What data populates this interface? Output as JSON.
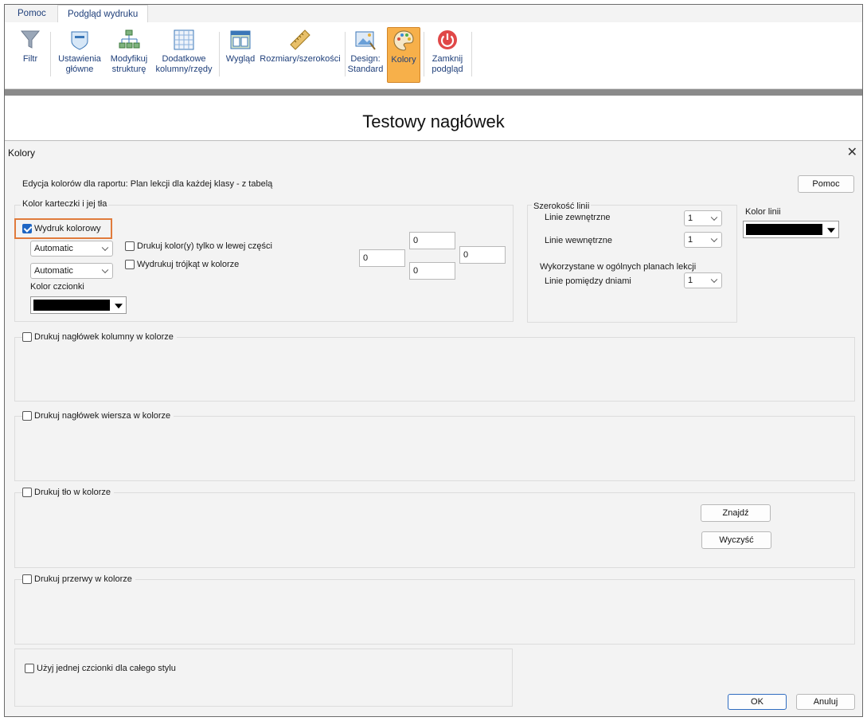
{
  "tabs": [
    {
      "label": "Pomoc"
    },
    {
      "label": "Podgląd wydruku"
    }
  ],
  "ribbon": {
    "filter": "Filtr",
    "main_settings": [
      "Ustawienia",
      "główne"
    ],
    "modify_structure": [
      "Modyfikuj",
      "strukturę"
    ],
    "extra_cols": [
      "Dodatkowe",
      "kolumny/rzędy"
    ],
    "appearance": "Wygląd",
    "sizes": "Rozmiary/szerokości",
    "design": [
      "Design:",
      "Standard"
    ],
    "colors": "Kolory",
    "close_preview": [
      "Zamknij",
      "podgląd"
    ]
  },
  "preview": {
    "header": "Testowy nagłówek"
  },
  "dialog": {
    "title": "Kolory",
    "close": "✕",
    "subtitle": "Edycja kolorów dla raportu: Plan lekcji dla każdej klasy - z tabelą",
    "help_button": "Pomoc",
    "card_group": {
      "label": "Kolor karteczki i jej tła",
      "color_print": {
        "label": "Wydruk kolorowy",
        "checked": true
      },
      "select1": "Automatic",
      "select2": "Automatic",
      "left_only": "Drukuj kolor(y) tylko w lewej części",
      "triangle": "Wydrukuj trójkąt w kolorze",
      "font_color": "Kolor czcionki",
      "margins": {
        "top": "0",
        "left": "0",
        "right": "0",
        "bottom": "0"
      }
    },
    "line_width": {
      "label": "Szerokość linii",
      "outer": "Linie zewnętrzne",
      "outer_value": "1",
      "inner": "Linie wewnętrzne",
      "inner_value": "1",
      "general_label": "Wykorzystane w ogólnych planach lekcji",
      "between_days": "Linie pomiędzy dniami",
      "between_days_value": "1"
    },
    "line_color_label": "Kolor linii",
    "col_header": "Drukuj nagłówek kolumny w kolorze",
    "row_header": "Drukuj nagłówek wiersza w kolorze",
    "background": "Drukuj tło w kolorze",
    "find_button": "Znajdź",
    "clear_button": "Wyczyść",
    "breaks": "Drukuj przerwy w kolorze",
    "single_font": "Użyj jednej czcionki dla całego stylu",
    "ok_button": "OK",
    "cancel_button": "Anuluj"
  }
}
